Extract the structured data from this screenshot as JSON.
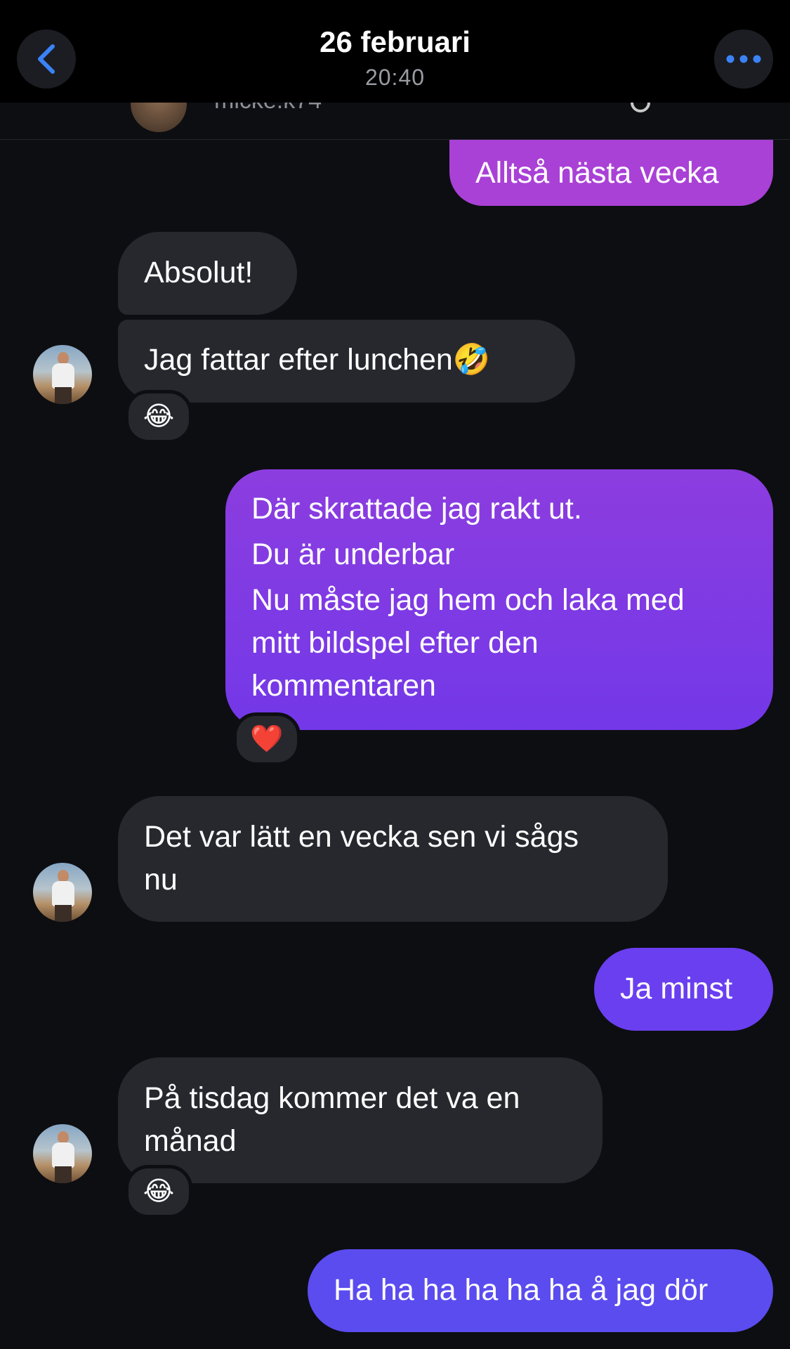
{
  "header": {
    "date": "26 februari",
    "time": "20:40",
    "back_icon": "chevron-left-icon",
    "more_icon": "more-horizontal-icon",
    "accent_color": "#3b82f6"
  },
  "profile_peek": {
    "username": "micke.k74"
  },
  "messages": [
    {
      "from": "me",
      "text_lines": [
        "Alltså nästa vecka"
      ]
    },
    {
      "from": "them",
      "text_lines": [
        "Absolut!"
      ]
    },
    {
      "from": "them",
      "text_lines": [
        "Jag fattar efter lunchen🤣"
      ],
      "reaction": "😂"
    },
    {
      "from": "me",
      "text_lines": [
        "Där skrattade jag rakt ut.",
        "Du är underbar",
        "Nu måste jag hem och laka med",
        "mitt bildspel efter den",
        "kommentaren"
      ],
      "reaction": "❤️"
    },
    {
      "from": "them",
      "text_lines": [
        "Det var lätt en vecka sen vi sågs",
        "nu"
      ]
    },
    {
      "from": "me",
      "text_lines": [
        "Ja minst"
      ]
    },
    {
      "from": "them",
      "text_lines": [
        "På tisdag kommer det va en",
        "månad"
      ],
      "reaction": "😂"
    },
    {
      "from": "me",
      "text_lines": [
        "Ha ha ha ha ha ha å jag dör"
      ]
    }
  ],
  "colors": {
    "background": "#0d0e12",
    "incoming_bubble": "#26282e",
    "outgoing_gradient_top": "#a53fd6",
    "outgoing_gradient_bottom": "#5a4bef"
  }
}
